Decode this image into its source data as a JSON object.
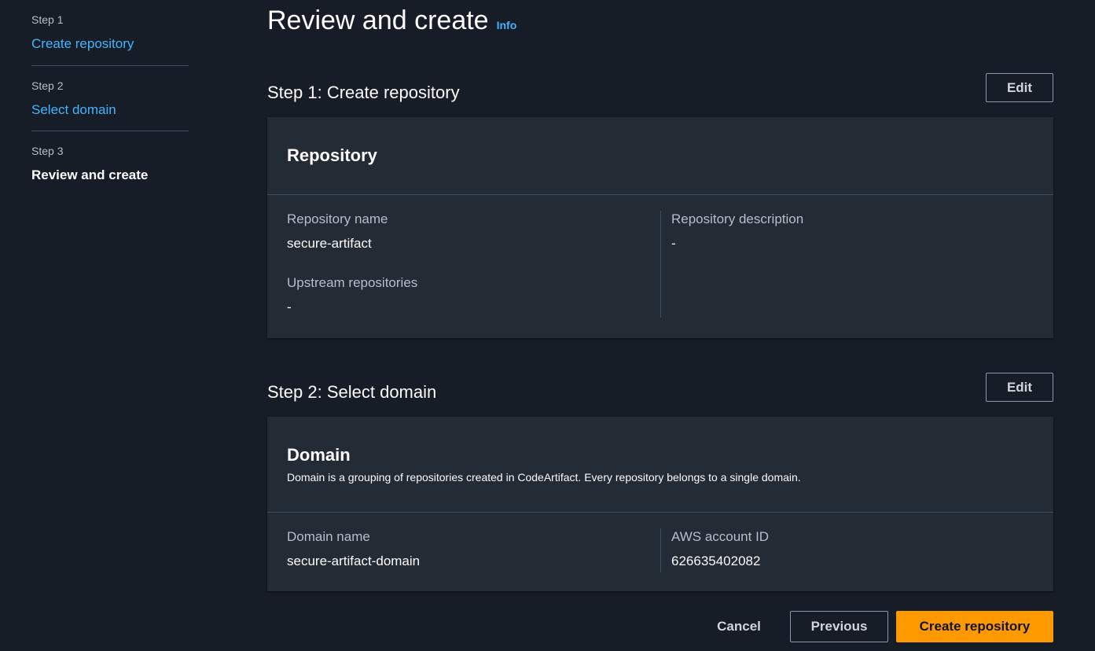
{
  "nav": {
    "steps": [
      {
        "number": "Step 1",
        "label": "Create repository"
      },
      {
        "number": "Step 2",
        "label": "Select domain"
      },
      {
        "number": "Step 3",
        "label": "Review and create"
      }
    ]
  },
  "header": {
    "title": "Review and create",
    "info": "Info"
  },
  "section1": {
    "title": "Step 1: Create repository",
    "edit": "Edit",
    "container_title": "Repository",
    "fields": {
      "repo_name_label": "Repository name",
      "repo_name_value": "secure-artifact",
      "upstream_label": "Upstream repositories",
      "upstream_value": "-",
      "description_label": "Repository description",
      "description_value": "-"
    }
  },
  "section2": {
    "title": "Step 2: Select domain",
    "edit": "Edit",
    "container_title": "Domain",
    "container_description": "Domain is a grouping of repositories created in CodeArtifact. Every repository belongs to a single domain.",
    "fields": {
      "domain_name_label": "Domain name",
      "domain_name_value": "secure-artifact-domain",
      "account_label": "AWS account ID",
      "account_value": "626635402082"
    }
  },
  "footer": {
    "cancel": "Cancel",
    "previous": "Previous",
    "create": "Create repository"
  },
  "colors": {
    "background": "#161d26",
    "container": "#232b35",
    "link": "#42b4ff",
    "primary": "#ff9900"
  }
}
